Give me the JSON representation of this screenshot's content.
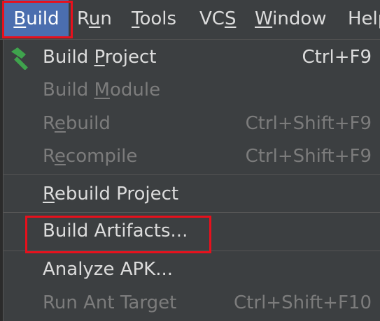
{
  "menubar": {
    "items": [
      {
        "mnemonic": "B",
        "rest": "uild"
      },
      {
        "pre": "R",
        "mnemonic": "u",
        "rest": "n"
      },
      {
        "mnemonic": "T",
        "rest": "ools"
      },
      {
        "pre": "VC",
        "mnemonic": "S",
        "rest": ""
      },
      {
        "mnemonic": "W",
        "rest": "indow"
      },
      {
        "pre": "Hel",
        "mnemonic": "p",
        "rest": ""
      }
    ]
  },
  "build_menu": {
    "items": [
      {
        "icon": "hammer-icon",
        "pre": "Build ",
        "mnemonic": "P",
        "rest": "roject",
        "shortcut": "Ctrl+F9",
        "enabled": true
      },
      {
        "pre": "Build ",
        "mnemonic": "M",
        "rest": "odule",
        "shortcut": "",
        "enabled": false
      },
      {
        "pre": "R",
        "mnemonic": "e",
        "rest": "build",
        "shortcut": "Ctrl+Shift+F9",
        "enabled": false
      },
      {
        "pre": "R",
        "mnemonic": "e",
        "rest": "compile",
        "shortcut": "Ctrl+Shift+F9",
        "enabled": false
      },
      {
        "pre": "",
        "mnemonic": "R",
        "rest": "ebuild Project",
        "shortcut": "",
        "enabled": true
      },
      {
        "pre": "Build Artifacts...",
        "mnemonic": "",
        "rest": "",
        "shortcut": "",
        "enabled": true
      },
      {
        "pre": "Analyze APK...",
        "mnemonic": "",
        "rest": "",
        "shortcut": "",
        "enabled": true
      },
      {
        "pre": "Run Ant Target",
        "mnemonic": "",
        "rest": "",
        "shortcut": "Ctrl+Shift+F10",
        "enabled": false
      }
    ]
  },
  "colors": {
    "accent": "#4b6eaf",
    "highlight": "#e8101c",
    "hammer": "#3fa34d"
  }
}
